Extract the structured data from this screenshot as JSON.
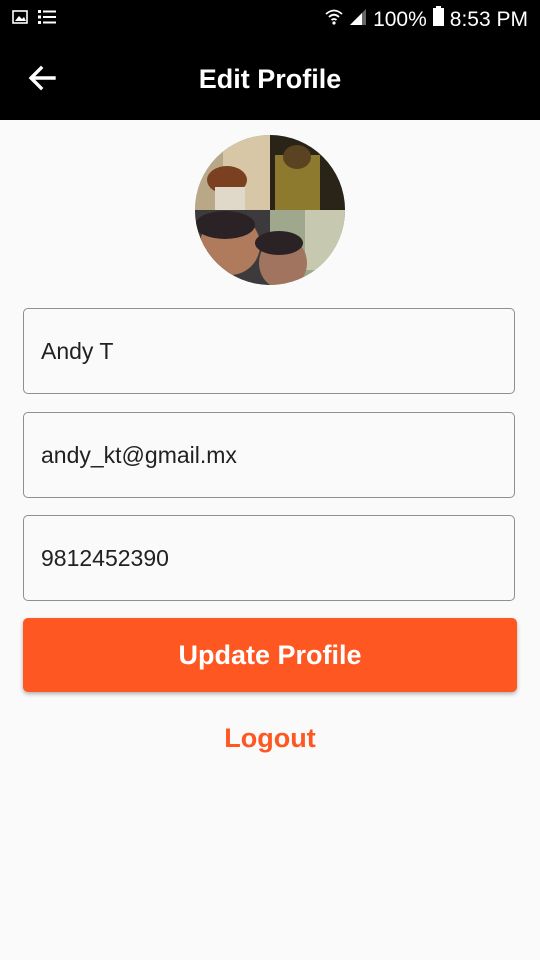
{
  "status_bar": {
    "battery": "100%",
    "time": "8:53 PM",
    "icons": [
      "gallery-icon",
      "list-icon",
      "wifi-icon",
      "signal-icon",
      "battery-icon"
    ]
  },
  "app_bar": {
    "title": "Edit Profile",
    "back_icon": "arrow-left-icon"
  },
  "profile": {
    "name": "Andy T",
    "email": "andy_kt@gmail.mx",
    "phone": "9812452390"
  },
  "actions": {
    "update_label": "Update Profile",
    "logout_label": "Logout"
  },
  "colors": {
    "accent": "#ff5722",
    "app_bar": "#000000",
    "background": "#fafafa",
    "field_border": "#8f8f8f"
  }
}
